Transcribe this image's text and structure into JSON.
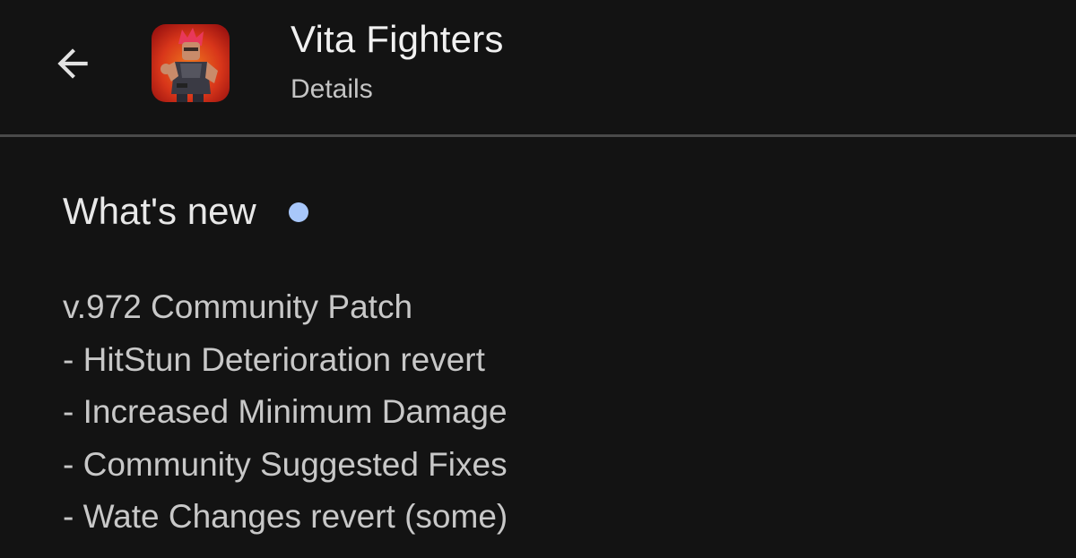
{
  "header": {
    "back_icon": "arrow-back-icon",
    "app_icon": "vita-fighters-app-icon",
    "title": "Vita Fighters",
    "subtitle": "Details"
  },
  "whats_new": {
    "title": "What's new",
    "indicator_color": "#a8c7fa",
    "notes": [
      "v.972 Community Patch",
      "- HitStun Deterioration revert",
      "- Increased Minimum Damage",
      "- Community Suggested Fixes",
      "- Wate Changes revert (some)"
    ]
  },
  "colors": {
    "background": "#131313",
    "divider": "#4a4a4a",
    "accent": "#a8c7fa"
  }
}
